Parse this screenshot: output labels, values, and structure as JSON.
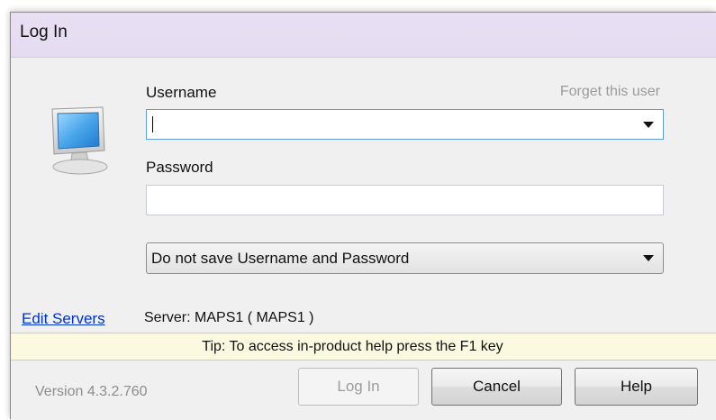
{
  "window": {
    "title": "Log In"
  },
  "form": {
    "username_label": "Username",
    "username_value": "",
    "forget_user_label": "Forget this user",
    "password_label": "Password",
    "password_value": "",
    "save_option": "Do not save Username and Password"
  },
  "server": {
    "edit_servers_label": "Edit Servers",
    "server_text": "Server: MAPS1 ( MAPS1 )"
  },
  "tip": {
    "text": "Tip: To access in-product help press the F1 key"
  },
  "footer": {
    "version": "Version 4.3.2.760",
    "login_label": "Log In",
    "cancel_label": "Cancel",
    "help_label": "Help"
  },
  "icons": {
    "monitor": "monitor-icon",
    "username_dropdown": "chevron-down-icon",
    "save_dropdown": "chevron-down-icon"
  },
  "colors": {
    "titlebar": "#e8ddf3",
    "tip_background": "#fbfae1",
    "link": "#0033cc",
    "focus_border": "#5b9fd6"
  }
}
